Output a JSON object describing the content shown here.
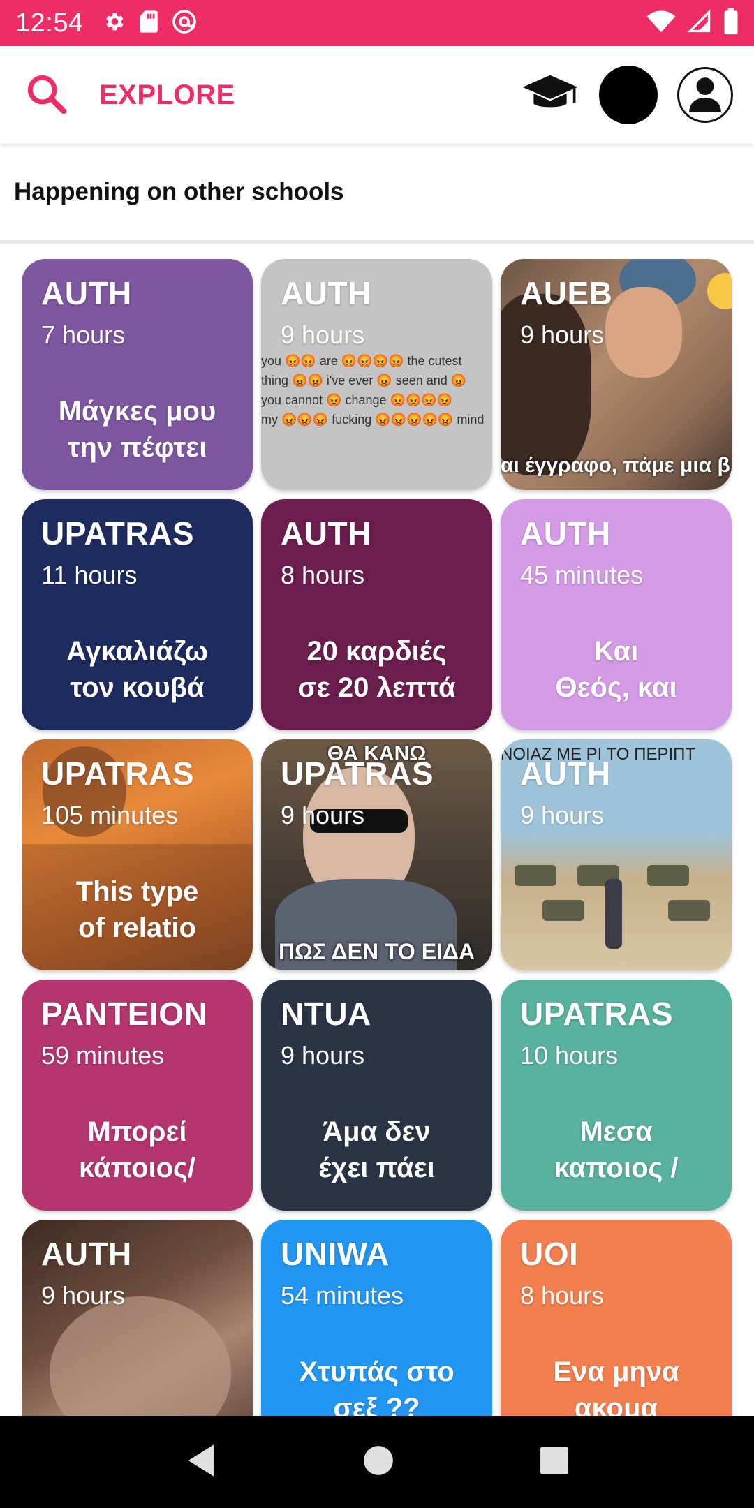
{
  "status_bar": {
    "time": "12:54",
    "icons": [
      "gear-icon",
      "sd-card-icon",
      "at-sign-icon",
      "wifi-icon",
      "signal-icon",
      "battery-icon"
    ]
  },
  "app_bar": {
    "title": "EXPLORE",
    "accent_color": "#EE2D66",
    "icons": [
      "search-icon",
      "graduation-cap-icon",
      "black-circle",
      "profile-icon"
    ]
  },
  "section": {
    "title": "Happening on other schools"
  },
  "cards": [
    {
      "school": "AUTH",
      "time": "7 hours",
      "snippet": "Μάγκες μου\nτην πέφτει",
      "color": "#7D57A0"
    },
    {
      "school": "AUTH",
      "time": "9 hours",
      "snippet": "",
      "image": "emoji-text-meme",
      "meme_lines": [
        "you 😡😡 are 😡😡😡😡 the cutest",
        "thing 😡😡 i've ever 😡 seen and 😡",
        "you cannot 😡 change 😡😡😡😡",
        "my 😡😡😡 fucking 😡😡😡😡😡 mind"
      ]
    },
    {
      "school": "AUEB",
      "time": "9 hours",
      "snippet": "",
      "image": "movie-still-meme",
      "meme_caption": "αι έγγραφο, πάμε μια β"
    },
    {
      "school": "UPATRAS",
      "time": "11 hours",
      "snippet": "Αγκαλιάζω\nτον κουβά",
      "color": "#1D2B5E"
    },
    {
      "school": "AUTH",
      "time": "8 hours",
      "snippet": "20 καρδιές\nσε 20 λεπτά",
      "color": "#6B1E4E"
    },
    {
      "school": "AUTH",
      "time": "45 minutes",
      "snippet": "Και\nΘεός, και",
      "color": "#D49CE6"
    },
    {
      "school": "UPATRAS",
      "time": "105 minutes",
      "snippet": "This type\nof relatio",
      "image": "orange-photo"
    },
    {
      "school": "UPATRAS",
      "time": "9 hours",
      "snippet": "",
      "image": "sunglasses-man-meme",
      "meme_top": "ΘΑ ΚΑΝΩ",
      "meme_caption": "ΠΩΣ ΔΕΝ ΤΟ ΕΙΔΑ"
    },
    {
      "school": "AUTH",
      "time": "9 hours",
      "snippet": "",
      "image": "game-screenshot-meme",
      "meme_top": "ΝΟΙΑΖ ΜΕ ΡΙ ΤΟ ΠΕΡΙΠΤ"
    },
    {
      "school": "PANTEION",
      "time": "59 minutes",
      "snippet": "Μπορεί\nκάποιος/",
      "color": "#B5356F"
    },
    {
      "school": "NTUA",
      "time": "9 hours",
      "snippet": "Άμα δεν\nέχει πάει",
      "color": "#2A3444"
    },
    {
      "school": "UPATRAS",
      "time": "10 hours",
      "snippet": "Μεσα\nκαποιος /",
      "color": "#58B29E"
    },
    {
      "school": "AUTH",
      "time": "9 hours",
      "snippet": "",
      "image": "brown-photo"
    },
    {
      "school": "UNIWA",
      "time": "54 minutes",
      "snippet": "Χτυπάς στο\nσεξ ??",
      "color": "#2196F3"
    },
    {
      "school": "UOI",
      "time": "8 hours",
      "snippet": "Ενα μηνα\nακομα",
      "color": "#F47F4E"
    }
  ],
  "nav_bar": {
    "icons": [
      "back-icon",
      "home-icon",
      "recents-icon"
    ]
  }
}
